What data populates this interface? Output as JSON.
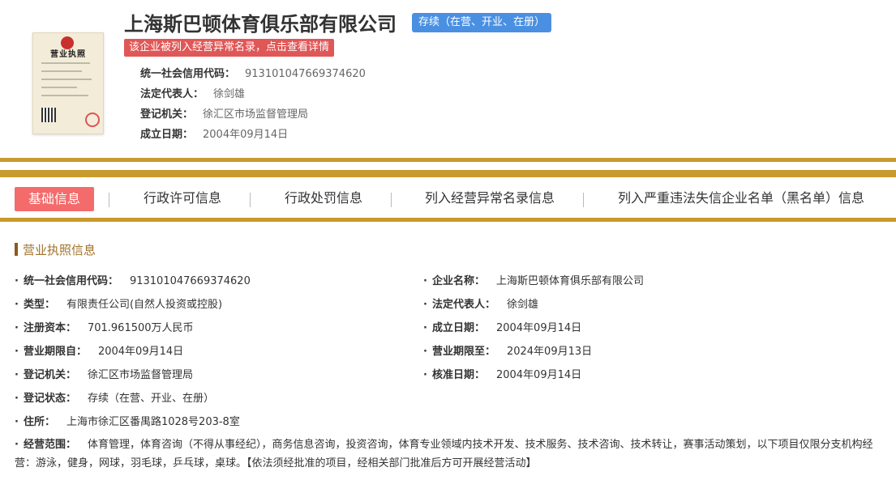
{
  "header": {
    "company_name": "上海斯巴顿体育俱乐部有限公司",
    "status_tag": "存续（在营、开业、在册）",
    "alert_tag": "该企业被列入经营异常名录，点击查看详情",
    "license_image_title": "营业执照",
    "info": [
      {
        "key": "统一社会信用代码：",
        "value": "913101047669374620"
      },
      {
        "key": "法定代表人：",
        "value": "徐剑雄"
      },
      {
        "key": "登记机关：",
        "value": "徐汇区市场监督管理局"
      },
      {
        "key": "成立日期：",
        "value": "2004年09月14日"
      }
    ]
  },
  "tabs": [
    {
      "label": "基础信息",
      "active": true
    },
    {
      "label": "行政许可信息"
    },
    {
      "label": "行政处罚信息"
    },
    {
      "label": "列入经营异常名录信息"
    },
    {
      "label": "列入严重违法失信企业名单（黑名单）信息"
    }
  ],
  "section": {
    "title": "营业执照信息",
    "fields": {
      "credit_code": {
        "key": "统一社会信用代码：",
        "value": "913101047669374620"
      },
      "company_name": {
        "key": "企业名称：",
        "value": "上海斯巴顿体育俱乐部有限公司"
      },
      "type": {
        "key": "类型：",
        "value": "有限责任公司(自然人投资或控股)"
      },
      "legal_rep": {
        "key": "法定代表人：",
        "value": "徐剑雄"
      },
      "capital": {
        "key": "注册资本：",
        "value": "701.961500万人民币"
      },
      "established": {
        "key": "成立日期：",
        "value": "2004年09月14日"
      },
      "term_from": {
        "key": "营业期限自：",
        "value": "2004年09月14日"
      },
      "term_to": {
        "key": "营业期限至：",
        "value": "2024年09月13日"
      },
      "authority": {
        "key": "登记机关：",
        "value": "徐汇区市场监督管理局"
      },
      "approval_date": {
        "key": "核准日期：",
        "value": "2004年09月14日"
      },
      "status": {
        "key": "登记状态：",
        "value": "存续（在营、开业、在册）"
      },
      "address": {
        "key": "住所：",
        "value": "上海市徐汇区番禺路1028号203-8室"
      },
      "scope": {
        "key": "经营范围：",
        "value": "体育管理，体育咨询（不得从事经纪），商务信息咨询，投资咨询，体育专业领域内技术开发、技术服务、技术咨询、技术转让，赛事活动策划，以下项目仅限分支机构经营：游泳，健身，网球，羽毛球，乒乓球，桌球。【依法须经批准的项目，经相关部门批准后方可开展经营活动】"
      }
    }
  },
  "colors": {
    "gold": "#c99a2e",
    "active_tab": "#f36b6b",
    "status_tag": "#4a90e2",
    "alert_tag": "#e05757"
  }
}
